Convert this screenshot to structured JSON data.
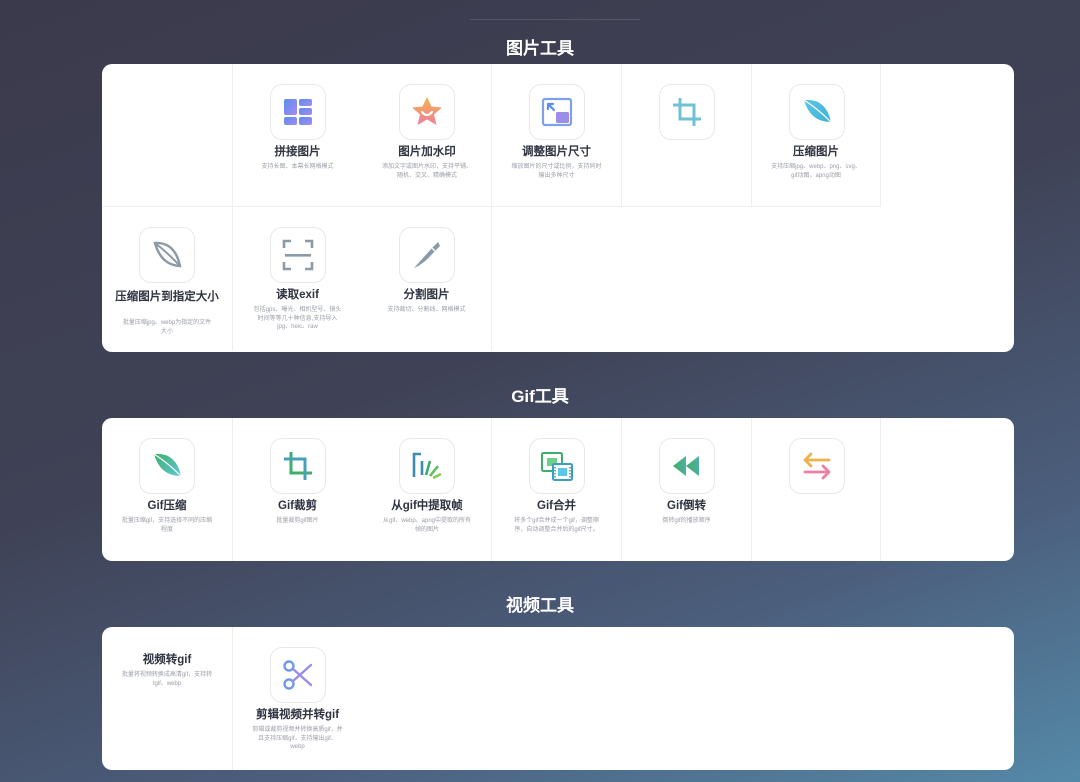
{
  "sections": [
    {
      "title": "图片工具",
      "tools": [
        {
          "title": "",
          "desc": "",
          "icon": ""
        },
        {
          "title": "拼接图片",
          "desc": "支持长图、本幕长网格模式",
          "icon": "grid-layout-icon"
        },
        {
          "title": "图片加水印",
          "desc": "添加文字或图片水印，支持平铺、随机、交叉、精确模式",
          "icon": "star-badge-icon"
        },
        {
          "title": "调整图片尺寸",
          "desc": "缩放图片的尺寸或比例，支持同时输出多种尺寸",
          "icon": "resize-icon"
        },
        {
          "title": "",
          "desc": "",
          "icon": "crop-icon"
        },
        {
          "title": "压缩图片",
          "desc": "支持压缩jpg、webp、png、svg、gif动图、apng动图",
          "icon": "leaf-icon"
        },
        {
          "title": "压缩图片到指定大小",
          "desc": "批量压缩jpg、webp为指定的文件大小",
          "icon": "leaf-outline-icon"
        },
        {
          "title": "读取exif",
          "desc": "包括gps、曝光、相机型号、镜头时间等等几十种信息,支持导入jpg、heic、raw",
          "icon": "scan-icon"
        },
        {
          "title": "分割图片",
          "desc": "支持裁切、分割线、网格模式",
          "icon": "knife-icon"
        }
      ]
    },
    {
      "title": "Gif工具",
      "tools": [
        {
          "title": "Gif压缩",
          "desc": "批量压缩gif，支持选择不同的压缩程度",
          "icon": "leaf-green-icon"
        },
        {
          "title": "Gif裁剪",
          "desc": "批量裁剪gif图片",
          "icon": "crop-green-icon"
        },
        {
          "title": "从gif中提取帧",
          "desc": "从gif、webp、apng中提取的所有帧的图片",
          "icon": "burst-icon"
        },
        {
          "title": "Gif合并",
          "desc": "将多个gif合并成一个gif，调整顺序，自动调整合并后的gif尺寸。",
          "icon": "film-icon"
        },
        {
          "title": "Gif倒转",
          "desc": "倒转gif的播放顺序",
          "icon": "rewind-icon"
        },
        {
          "title": "",
          "desc": "",
          "icon": "swap-arrows-icon"
        }
      ]
    },
    {
      "title": "视频工具",
      "tools": [
        {
          "title": "视频转gif",
          "desc": "批量将视频转换成高清gif，支持转tgif、webp",
          "icon": ""
        },
        {
          "title": "剪辑视频并转gif",
          "desc": "剪辑或裁剪视频并转换高质gif，并且支持压缩gif，支持输出gif、webp",
          "icon": "scissors-icon"
        }
      ]
    }
  ]
}
